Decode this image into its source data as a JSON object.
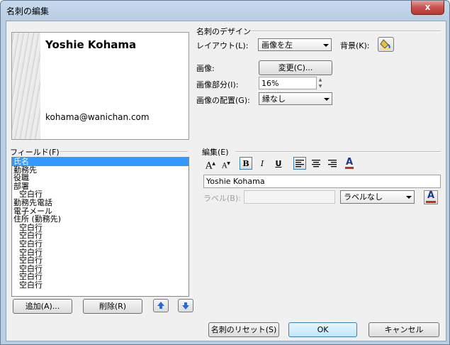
{
  "window": {
    "title": "名刺の編集",
    "close_glyph": "x"
  },
  "card_preview": {
    "name": "Yoshie Kohama",
    "email": "kohama@wanichan.com"
  },
  "design": {
    "section_label": "名刺のデザイン",
    "layout_label": "レイアウト(L):",
    "layout_value": "画像を左",
    "background_label": "背景(K):",
    "image_label": "画像:",
    "change_button": "変更(C)...",
    "image_area_label": "画像部分(I):",
    "image_area_value": "16%",
    "image_align_label": "画像の配置(G):",
    "image_align_value": "縁なし"
  },
  "fields": {
    "section_label": "フィールド(F)",
    "items": [
      "氏名",
      "勤務先",
      "役職",
      "部署",
      "空白行",
      "勤務先電話",
      "電子メール",
      "住所 (勤務先)",
      "空白行",
      "空白行",
      "空白行",
      "空白行",
      "空白行",
      "空白行",
      "空白行",
      "空白行"
    ],
    "add_button": "追加(A)...",
    "delete_button": "削除(R)"
  },
  "edit": {
    "section_label": "編集(E)",
    "grow_font": "A",
    "shrink_font": "A",
    "bold": "B",
    "italic": "I",
    "underline": "U",
    "font_color": "A",
    "text_value": "Yoshie Kohama",
    "label_label": "ラベル(B):",
    "label_value": "",
    "label_position": "ラベルなし",
    "label_color": "A"
  },
  "footer": {
    "reset_button": "名刺のリセット(S)",
    "ok_button": "OK",
    "cancel_button": "キャンセル"
  },
  "colors": {
    "selection": "#3399ff",
    "font_color_bar": "#c03010",
    "title_close": "#c75050"
  }
}
